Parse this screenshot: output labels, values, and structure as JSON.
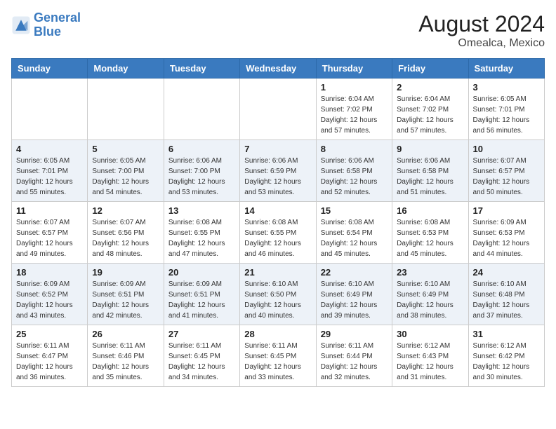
{
  "header": {
    "logo_line1": "General",
    "logo_line2": "Blue",
    "title": "August 2024",
    "subtitle": "Omealca, Mexico"
  },
  "days_of_week": [
    "Sunday",
    "Monday",
    "Tuesday",
    "Wednesday",
    "Thursday",
    "Friday",
    "Saturday"
  ],
  "weeks": [
    [
      {
        "day": "",
        "info": ""
      },
      {
        "day": "",
        "info": ""
      },
      {
        "day": "",
        "info": ""
      },
      {
        "day": "",
        "info": ""
      },
      {
        "day": "1",
        "info": "Sunrise: 6:04 AM\nSunset: 7:02 PM\nDaylight: 12 hours\nand 57 minutes."
      },
      {
        "day": "2",
        "info": "Sunrise: 6:04 AM\nSunset: 7:02 PM\nDaylight: 12 hours\nand 57 minutes."
      },
      {
        "day": "3",
        "info": "Sunrise: 6:05 AM\nSunset: 7:01 PM\nDaylight: 12 hours\nand 56 minutes."
      }
    ],
    [
      {
        "day": "4",
        "info": "Sunrise: 6:05 AM\nSunset: 7:01 PM\nDaylight: 12 hours\nand 55 minutes."
      },
      {
        "day": "5",
        "info": "Sunrise: 6:05 AM\nSunset: 7:00 PM\nDaylight: 12 hours\nand 54 minutes."
      },
      {
        "day": "6",
        "info": "Sunrise: 6:06 AM\nSunset: 7:00 PM\nDaylight: 12 hours\nand 53 minutes."
      },
      {
        "day": "7",
        "info": "Sunrise: 6:06 AM\nSunset: 6:59 PM\nDaylight: 12 hours\nand 53 minutes."
      },
      {
        "day": "8",
        "info": "Sunrise: 6:06 AM\nSunset: 6:58 PM\nDaylight: 12 hours\nand 52 minutes."
      },
      {
        "day": "9",
        "info": "Sunrise: 6:06 AM\nSunset: 6:58 PM\nDaylight: 12 hours\nand 51 minutes."
      },
      {
        "day": "10",
        "info": "Sunrise: 6:07 AM\nSunset: 6:57 PM\nDaylight: 12 hours\nand 50 minutes."
      }
    ],
    [
      {
        "day": "11",
        "info": "Sunrise: 6:07 AM\nSunset: 6:57 PM\nDaylight: 12 hours\nand 49 minutes."
      },
      {
        "day": "12",
        "info": "Sunrise: 6:07 AM\nSunset: 6:56 PM\nDaylight: 12 hours\nand 48 minutes."
      },
      {
        "day": "13",
        "info": "Sunrise: 6:08 AM\nSunset: 6:55 PM\nDaylight: 12 hours\nand 47 minutes."
      },
      {
        "day": "14",
        "info": "Sunrise: 6:08 AM\nSunset: 6:55 PM\nDaylight: 12 hours\nand 46 minutes."
      },
      {
        "day": "15",
        "info": "Sunrise: 6:08 AM\nSunset: 6:54 PM\nDaylight: 12 hours\nand 45 minutes."
      },
      {
        "day": "16",
        "info": "Sunrise: 6:08 AM\nSunset: 6:53 PM\nDaylight: 12 hours\nand 45 minutes."
      },
      {
        "day": "17",
        "info": "Sunrise: 6:09 AM\nSunset: 6:53 PM\nDaylight: 12 hours\nand 44 minutes."
      }
    ],
    [
      {
        "day": "18",
        "info": "Sunrise: 6:09 AM\nSunset: 6:52 PM\nDaylight: 12 hours\nand 43 minutes."
      },
      {
        "day": "19",
        "info": "Sunrise: 6:09 AM\nSunset: 6:51 PM\nDaylight: 12 hours\nand 42 minutes."
      },
      {
        "day": "20",
        "info": "Sunrise: 6:09 AM\nSunset: 6:51 PM\nDaylight: 12 hours\nand 41 minutes."
      },
      {
        "day": "21",
        "info": "Sunrise: 6:10 AM\nSunset: 6:50 PM\nDaylight: 12 hours\nand 40 minutes."
      },
      {
        "day": "22",
        "info": "Sunrise: 6:10 AM\nSunset: 6:49 PM\nDaylight: 12 hours\nand 39 minutes."
      },
      {
        "day": "23",
        "info": "Sunrise: 6:10 AM\nSunset: 6:49 PM\nDaylight: 12 hours\nand 38 minutes."
      },
      {
        "day": "24",
        "info": "Sunrise: 6:10 AM\nSunset: 6:48 PM\nDaylight: 12 hours\nand 37 minutes."
      }
    ],
    [
      {
        "day": "25",
        "info": "Sunrise: 6:11 AM\nSunset: 6:47 PM\nDaylight: 12 hours\nand 36 minutes."
      },
      {
        "day": "26",
        "info": "Sunrise: 6:11 AM\nSunset: 6:46 PM\nDaylight: 12 hours\nand 35 minutes."
      },
      {
        "day": "27",
        "info": "Sunrise: 6:11 AM\nSunset: 6:45 PM\nDaylight: 12 hours\nand 34 minutes."
      },
      {
        "day": "28",
        "info": "Sunrise: 6:11 AM\nSunset: 6:45 PM\nDaylight: 12 hours\nand 33 minutes."
      },
      {
        "day": "29",
        "info": "Sunrise: 6:11 AM\nSunset: 6:44 PM\nDaylight: 12 hours\nand 32 minutes."
      },
      {
        "day": "30",
        "info": "Sunrise: 6:12 AM\nSunset: 6:43 PM\nDaylight: 12 hours\nand 31 minutes."
      },
      {
        "day": "31",
        "info": "Sunrise: 6:12 AM\nSunset: 6:42 PM\nDaylight: 12 hours\nand 30 minutes."
      }
    ]
  ]
}
